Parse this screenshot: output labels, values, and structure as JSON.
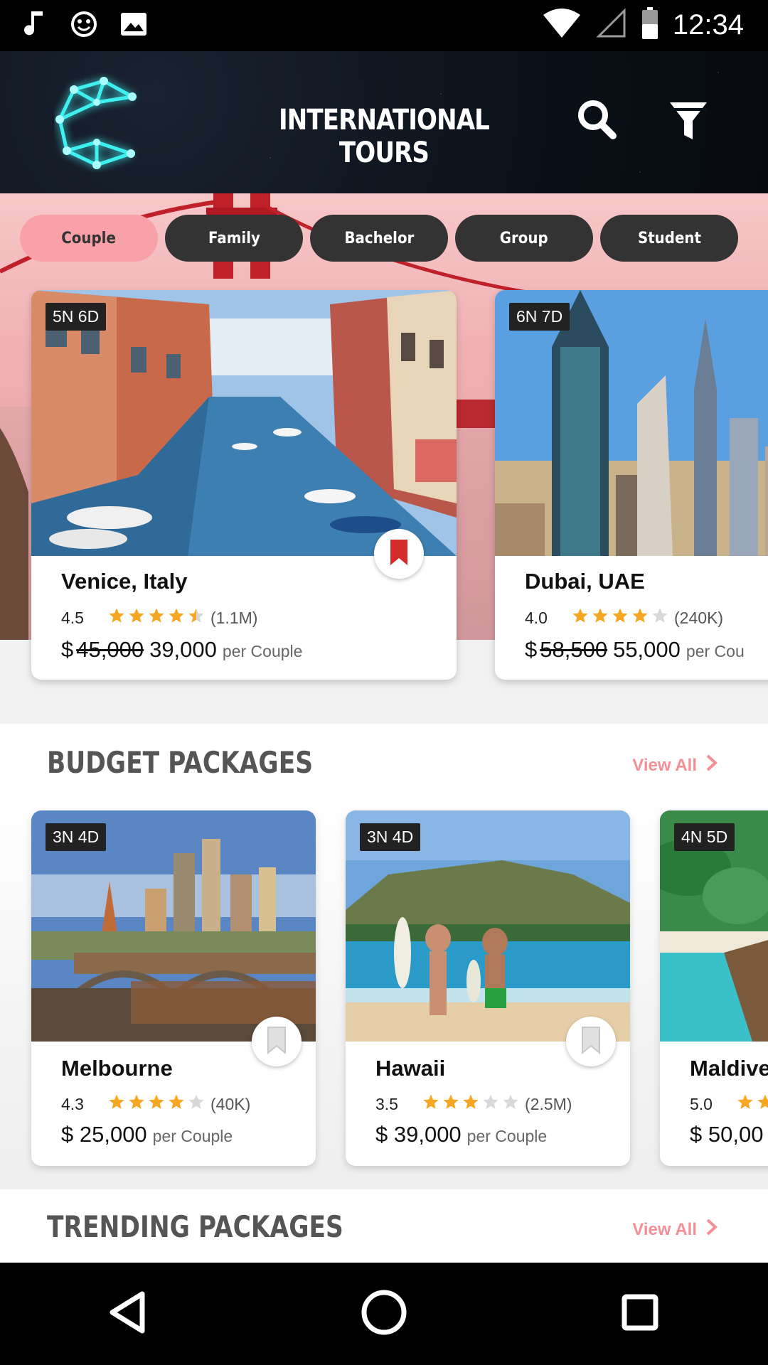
{
  "status_bar": {
    "time": "12:34",
    "left_icons": [
      "music-note-icon",
      "smiley-icon",
      "image-icon"
    ],
    "right_icons": [
      "wifi-icon",
      "signal-icon",
      "battery-icon"
    ]
  },
  "header": {
    "title": "INTERNATIONAL TOURS",
    "logo": "c-constellation-logo",
    "actions": [
      "search-icon",
      "filter-icon"
    ]
  },
  "categories": {
    "items": [
      "Couple",
      "Family",
      "Bachelor",
      "Group",
      "Student"
    ],
    "selected": "Couple"
  },
  "featured": [
    {
      "duration": "5N 6D",
      "name": "Venice, Italy",
      "rating": "4.5",
      "rating_value": 4.5,
      "reviews": "(1.1M)",
      "currency": "$",
      "old_price": "45,000",
      "price": "39,000",
      "per": "per Couple",
      "bookmarked": true
    },
    {
      "duration": "6N 7D",
      "name": "Dubai, UAE",
      "rating": "4.0",
      "rating_value": 4.0,
      "reviews": "(240K)",
      "currency": "$",
      "old_price": "58,500",
      "price": "55,000",
      "per": "per Cou",
      "bookmarked": false
    }
  ],
  "budget_packages": {
    "title": "BUDGET PACKAGES",
    "view_all": "View All",
    "items": [
      {
        "duration": "3N 4D",
        "name": "Melbourne",
        "rating": "4.3",
        "rating_value": 4.0,
        "reviews": "(40K)",
        "price": "$ 25,000",
        "per": "per Couple",
        "bookmarked": false
      },
      {
        "duration": "3N 4D",
        "name": "Hawaii",
        "rating": "3.5",
        "rating_value": 3.0,
        "reviews": "(2.5M)",
        "price": "$ 39,000",
        "per": "per Couple",
        "bookmarked": false
      },
      {
        "duration": "4N 5D",
        "name": "Maldive",
        "rating": "5.0",
        "rating_value": 5.0,
        "reviews": "",
        "price": "$ 50,00",
        "per": "",
        "bookmarked": false
      }
    ]
  },
  "trending_packages": {
    "title": "TRENDING PACKAGES",
    "view_all": "View All"
  },
  "nav_bar": [
    "back-icon",
    "home-icon",
    "recents-icon"
  ],
  "colors": {
    "accent_pink": "#f8a1a6",
    "chip_dark": "#333333",
    "star": "#f5a623",
    "bookmark_red": "#d62b2b",
    "logo_cyan": "#3ff0f0"
  }
}
